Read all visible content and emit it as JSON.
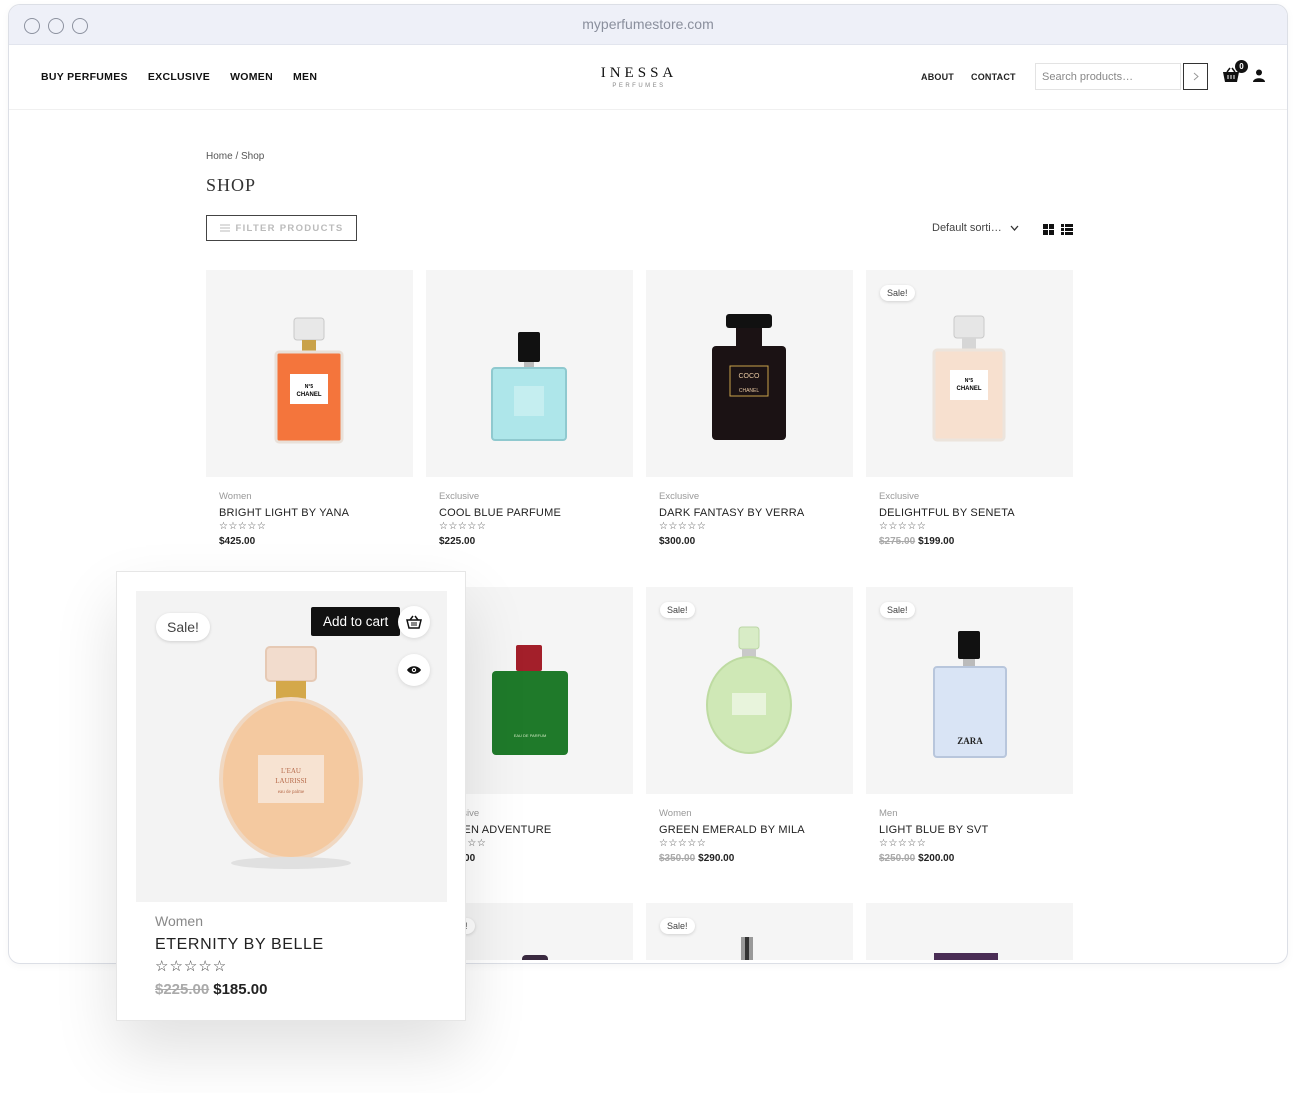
{
  "browser": {
    "url": "myperfumestore.com"
  },
  "nav": {
    "left": [
      "BUY PERFUMES",
      "EXCLUSIVE",
      "WOMEN",
      "MEN"
    ],
    "logo_main": "INESSA",
    "logo_sub": "PERFUMES",
    "right": [
      "ABOUT",
      "CONTACT"
    ],
    "search_placeholder": "Search products…",
    "cart_count": "0"
  },
  "breadcrumb": "Home / Shop",
  "page_title": "SHOP",
  "filter_label": "FILTER PRODUCTS",
  "sorting_label": "Default sorti…",
  "stars_glyph": "☆☆☆☆☆",
  "sale_label": "Sale!",
  "products": [
    {
      "category": "Women",
      "name": "BRIGHT LIGHT BY YANA",
      "old_price": "",
      "price": "$425.00",
      "sale": false,
      "bottle_color": "#f4753c",
      "bottle_label": "N°5 CHANEL"
    },
    {
      "category": "Exclusive",
      "name": "COOL BLUE PARFUME",
      "old_price": "",
      "price": "$225.00",
      "sale": false,
      "bottle_color": "#aee6ea",
      "bottle_label": ""
    },
    {
      "category": "Exclusive",
      "name": "DARK FANTASY BY VERRA",
      "old_price": "",
      "price": "$300.00",
      "sale": false,
      "bottle_color": "#1b1214",
      "bottle_label": "COCO CHANEL"
    },
    {
      "category": "Exclusive",
      "name": "DELIGHTFUL BY SENETA",
      "old_price": "$275.00",
      "price": "$199.00",
      "sale": true,
      "bottle_color": "#f7e0cf",
      "bottle_label": "N°5 CHANEL"
    },
    {
      "category": "Exclusive",
      "name": "GREEN ADVENTURE",
      "old_price": "",
      "price": "$235.00",
      "sale": false,
      "bottle_color": "#1f7a2a",
      "bottle_label": "EAU DE PARFUM"
    },
    {
      "category": "Women",
      "name": "GREEN EMERALD BY MILA",
      "old_price": "$350.00",
      "price": "$290.00",
      "sale": true,
      "bottle_color": "#cfe8b6",
      "bottle_label": "L'EAU LAURISSI"
    },
    {
      "category": "Men",
      "name": "LIGHT BLUE BY SVT",
      "old_price": "$250.00",
      "price": "$200.00",
      "sale": true,
      "bottle_color": "#d9e4f5",
      "bottle_label": "ZARA"
    }
  ],
  "row3": [
    {
      "sale": true
    },
    {
      "sale": true
    },
    {
      "sale": false
    }
  ],
  "popup": {
    "category": "Women",
    "name": "ETERNITY BY BELLE",
    "old_price": "$225.00",
    "price": "$185.00",
    "tooltip": "Add to cart",
    "bottle_label_1": "L'EAU",
    "bottle_label_2": "LAURISSI",
    "bottle_label_3": "eau de palme"
  },
  "icons": [
    "cart-icon",
    "user-icon",
    "grid-icon",
    "list-icon",
    "basket-icon",
    "eye-icon",
    "chevron-down-icon",
    "chevron-right-icon",
    "filter-icon"
  ]
}
